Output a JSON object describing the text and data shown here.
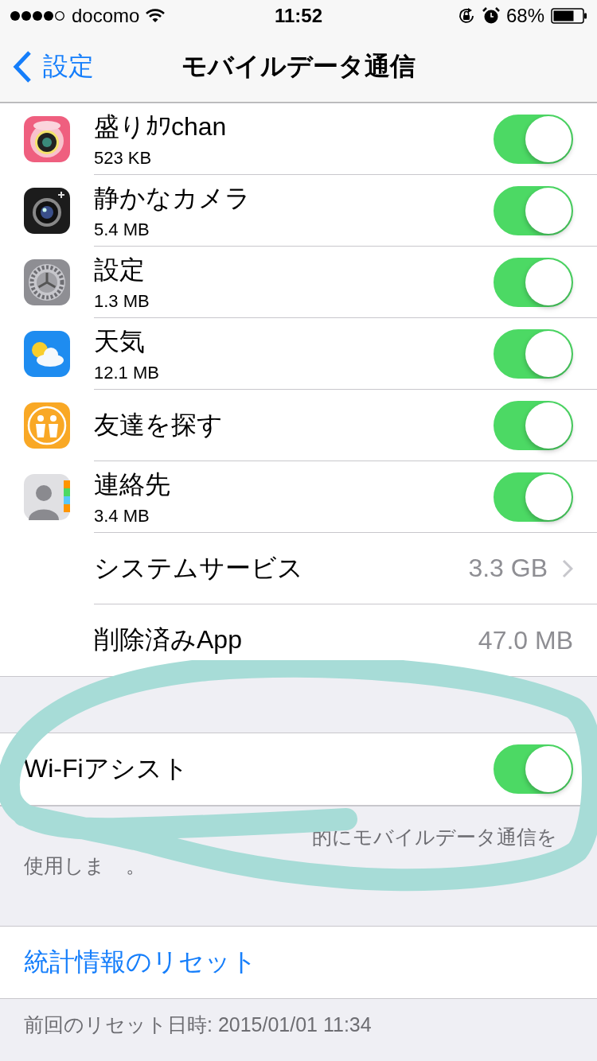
{
  "status_bar": {
    "carrier": "docomo",
    "time": "11:52",
    "battery": "68%"
  },
  "nav": {
    "back": "設定",
    "title": "モバイルデータ通信"
  },
  "apps": [
    {
      "kind": "beauty",
      "name": "盛りｶﾜchan",
      "usage": "523 KB",
      "on": true
    },
    {
      "kind": "camera",
      "name": "静かなカメラ",
      "usage": "5.4 MB",
      "on": true
    },
    {
      "kind": "settings",
      "name": "設定",
      "usage": "1.3 MB",
      "on": true
    },
    {
      "kind": "weather",
      "name": "天気",
      "usage": "12.1 MB",
      "on": true
    },
    {
      "kind": "friends",
      "name": "友達を探す",
      "on": true
    },
    {
      "kind": "contacts",
      "name": "連絡先",
      "usage": "3.4 MB",
      "on": true
    }
  ],
  "summary_rows": [
    {
      "kind": "link",
      "label": "システムサービス",
      "value": "3.3 GB"
    },
    {
      "kind": "info",
      "label": "削除済みApp",
      "value": "47.0 MB"
    }
  ],
  "wifi_assist": {
    "label": "Wi-Fiアシスト",
    "on": true,
    "footer_visible_lines": [
      [
        "的にモバイルデータ通信を"
      ],
      [
        "使用しま",
        "。"
      ]
    ]
  },
  "reset": {
    "label": "統計情報のリセット",
    "last_reset": "前回のリセット日時: 2015/01/01 11:34"
  }
}
